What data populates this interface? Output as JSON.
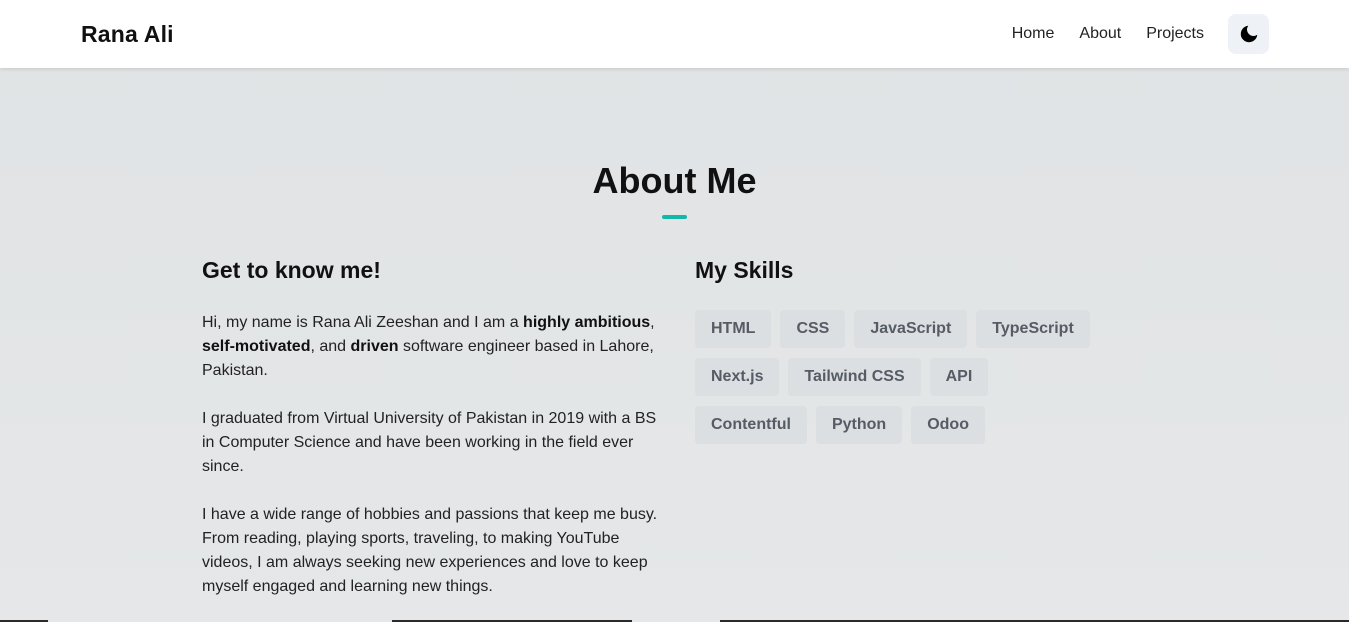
{
  "header": {
    "brand": "Rana Ali",
    "nav": [
      {
        "label": "Home"
      },
      {
        "label": "About"
      },
      {
        "label": "Projects"
      }
    ],
    "theme_toggle_icon": "moon-icon"
  },
  "about": {
    "title": "About Me",
    "accent_color": "#14b8a6",
    "intro_heading": "Get to know me!",
    "p1": {
      "a": "Hi, my name is Rana Ali Zeeshan and I am a ",
      "b1": "highly ambitious",
      "c": ", ",
      "b2": "self-motivated",
      "d": ", and ",
      "b3": "driven",
      "e": " software engineer based in Lahore, Pakistan."
    },
    "p2": "I graduated from Virtual University of Pakistan in 2019 with a BS in Computer Science and have been working in the field ever since.",
    "p3": "I have a wide range of hobbies and passions that keep me busy. From reading, playing sports, traveling, to making YouTube videos, I am always seeking new experiences and love to keep myself engaged and learning new things.",
    "skills_heading": "My Skills",
    "skills": [
      "HTML",
      "CSS",
      "JavaScript",
      "TypeScript",
      "Next.js",
      "Tailwind CSS",
      "API",
      "Contentful",
      "Python",
      "Odoo"
    ]
  }
}
